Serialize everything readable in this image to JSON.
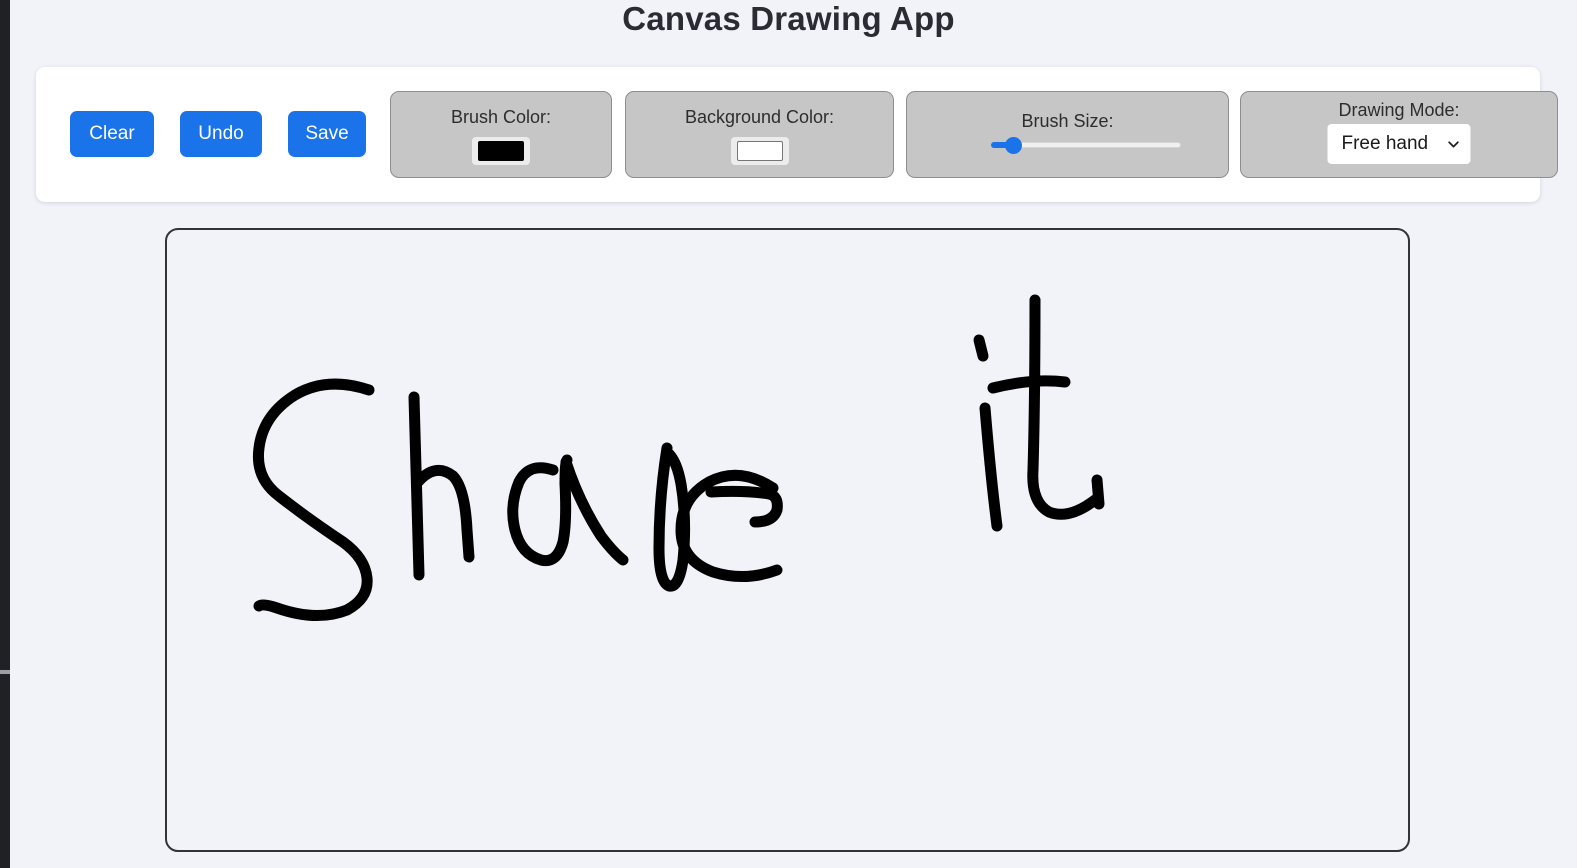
{
  "app": {
    "title": "Canvas Drawing App",
    "background_color": "#f2f2f9",
    "accent_color": "#1a73e8"
  },
  "toolbar": {
    "buttons": [
      {
        "id": "clear",
        "label": "Clear"
      },
      {
        "id": "undo",
        "label": "Undo"
      },
      {
        "id": "save",
        "label": "Save"
      }
    ],
    "brush_color": {
      "label": "Brush Color:",
      "value": "#000000"
    },
    "background_color": {
      "label": "Background Color:",
      "value": "#ffffff"
    },
    "brush_size": {
      "label": "Brush Size:",
      "value": 12,
      "min": 0,
      "max": 100
    },
    "drawing_mode": {
      "label": "Drawing Mode:",
      "selected": "Free hand",
      "chevron_icon": "chevron-down-icon",
      "options": [
        "Free hand"
      ]
    }
  },
  "canvas": {
    "drawn_text": "Shape it",
    "stroke_color": "#000000",
    "canvas_background": "#f2f2f9",
    "border_color": "#33333b"
  }
}
